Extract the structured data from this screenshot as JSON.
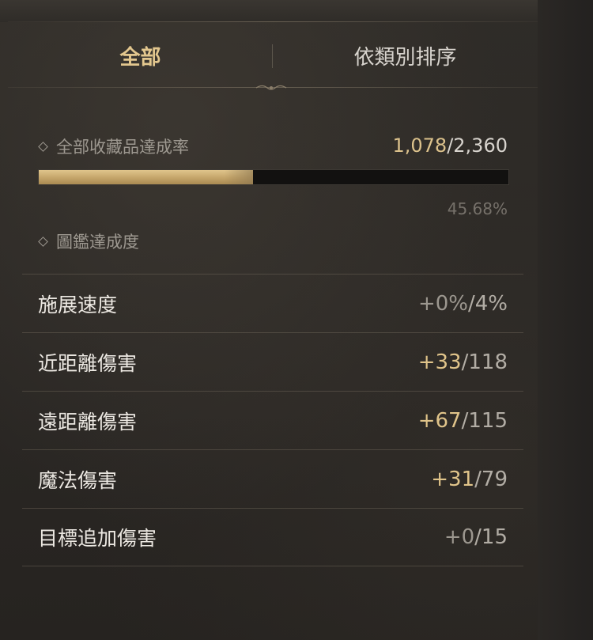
{
  "tabs": {
    "all_label": "全部",
    "category_label": "依類別排序"
  },
  "collection": {
    "label": "全部收藏品達成率",
    "current": "1,078",
    "separator": "/",
    "total": "2,360",
    "progress_fraction": 0.4568,
    "percent_text": "45.68%"
  },
  "codex": {
    "label": "圖鑑達成度"
  },
  "stats": [
    {
      "name": "施展速度",
      "bonus": "+0%",
      "separator": "/",
      "max": "4%",
      "active": false
    },
    {
      "name": "近距離傷害",
      "bonus": "+33",
      "separator": "/",
      "max": "118",
      "active": true
    },
    {
      "name": "遠距離傷害",
      "bonus": "+67",
      "separator": "/",
      "max": "115",
      "active": true
    },
    {
      "name": "魔法傷害",
      "bonus": "+31",
      "separator": "/",
      "max": "79",
      "active": true
    },
    {
      "name": "目標追加傷害",
      "bonus": "+0",
      "separator": "/",
      "max": "15",
      "active": false
    }
  ],
  "colors": {
    "accent_gold": "#e0c48a",
    "text_light": "#ece8e2",
    "text_muted": "#9d9890",
    "background": "#2b2825"
  },
  "icons": {
    "section_marker": "diamond-outline-icon",
    "divider_ornament": "ornament-flourish-icon"
  }
}
